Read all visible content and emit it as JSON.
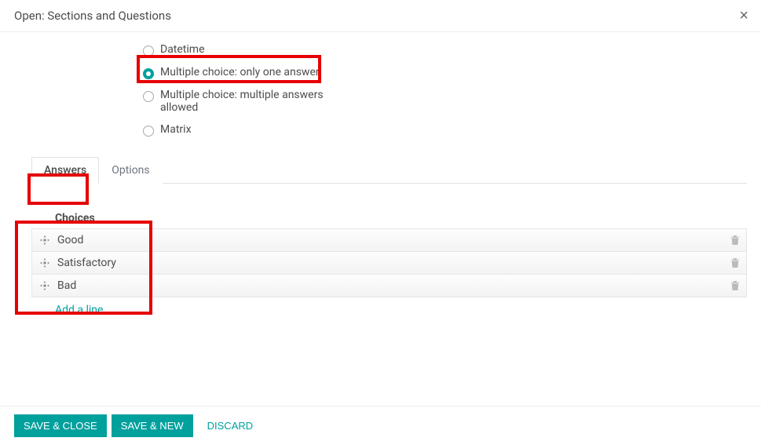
{
  "modal": {
    "title": "Open: Sections and Questions"
  },
  "question_types": {
    "datetime": "Datetime",
    "mc_single": "Multiple choice: only one answer",
    "mc_multi": "Multiple choice: multiple answers allowed",
    "matrix": "Matrix"
  },
  "tabs": {
    "answers": "Answers",
    "options": "Options"
  },
  "choices": {
    "header": "Choices",
    "items": [
      "Good",
      "Satisfactory",
      "Bad"
    ],
    "add_line": "Add a line"
  },
  "footer": {
    "save_close": "Save & Close",
    "save_new": "Save & New",
    "discard": "Discard"
  }
}
